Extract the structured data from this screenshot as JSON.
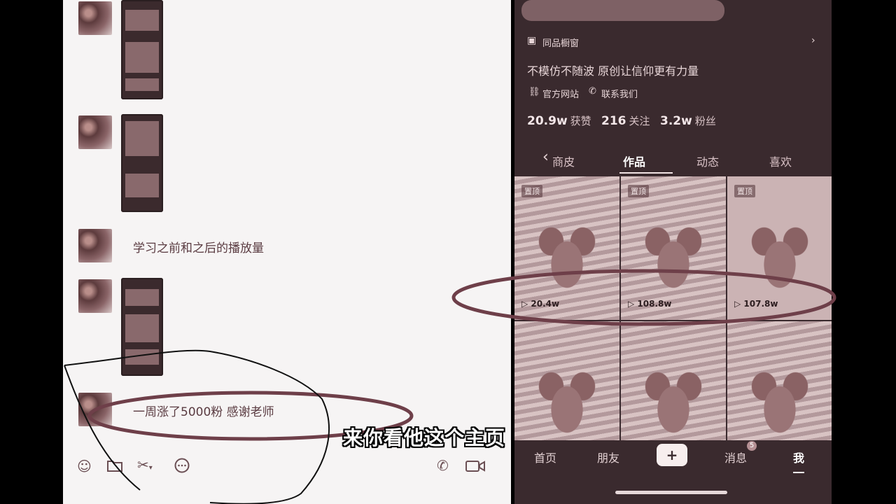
{
  "chat": {
    "messages": [
      {
        "type": "image"
      },
      {
        "type": "image"
      },
      {
        "type": "text",
        "text": "学习之前和之后的播放量"
      },
      {
        "type": "image"
      },
      {
        "type": "text",
        "text": "一周涨了5000粉  感谢老师"
      }
    ],
    "toolbar": {
      "emoji_icon": "emoji-icon",
      "folder_icon": "folder-icon",
      "scissors_icon": "scissors-icon",
      "comment_icon": "chat-bubble-icon",
      "phone_icon": "phone-icon",
      "video_icon": "video-call-icon"
    }
  },
  "profile": {
    "shop_label": "同品橱窗",
    "bio": "不模仿不随波 原创让信仰更有力量",
    "links": {
      "website": "官方网站",
      "contact": "联系我们"
    },
    "stats": [
      {
        "value": "20.9w",
        "label": "获赞"
      },
      {
        "value": "216",
        "label": "关注"
      },
      {
        "value": "3.2w",
        "label": "粉丝"
      }
    ],
    "tabs": [
      "商皮",
      "作品",
      "动态",
      "喜欢"
    ],
    "active_tab": "作品",
    "videos": [
      {
        "badge": "置顶",
        "plays": "20.4w"
      },
      {
        "badge": "置顶",
        "plays": "108.8w"
      },
      {
        "badge": "置顶",
        "plays": "107.8w"
      },
      {
        "badge": "",
        "plays": ""
      },
      {
        "badge": "",
        "plays": ""
      },
      {
        "badge": "",
        "plays": ""
      }
    ],
    "bottom_nav": {
      "home": "首页",
      "friends": "朋友",
      "plus": "+",
      "messages": "消息",
      "messages_badge": "5",
      "me": "我"
    }
  },
  "caption": "来你看他这个主页",
  "colors": {
    "annotation": "#6e3f49",
    "chat_bg": "#f6f4f4",
    "phone_bg": "#3a2a2e"
  }
}
